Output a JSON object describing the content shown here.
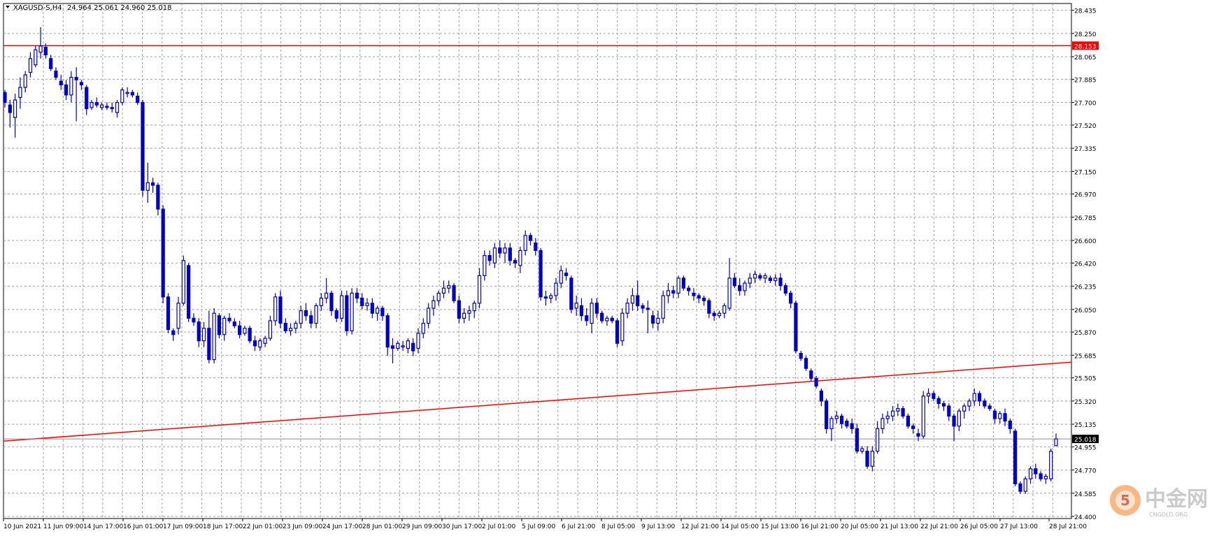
{
  "header": {
    "symbol": "XAGUSD-S,H4",
    "ohlc": "24.964 25.061 24.960 25.018"
  },
  "watermark": {
    "brand": "中金网",
    "url": "CNGOLD.ORG"
  },
  "chart_data": {
    "type": "candlestick",
    "symbol": "XAGUSD-S",
    "timeframe": "H4",
    "ohlc_last": {
      "open": 24.964,
      "high": 25.061,
      "low": 24.96,
      "close": 25.018
    },
    "ylim": [
      24.4,
      28.45
    ],
    "y_ticks": [
      "28.435",
      "28.250",
      "28.065",
      "27.885",
      "27.700",
      "27.520",
      "27.335",
      "27.150",
      "26.970",
      "26.785",
      "26.600",
      "26.420",
      "26.235",
      "26.050",
      "25.870",
      "25.685",
      "25.505",
      "25.320",
      "25.135",
      "24.955",
      "24.770",
      "24.585",
      "24.400"
    ],
    "x_ticks": [
      "10 Jun 2021",
      "11 Jun 09:00",
      "14 Jun 17:00",
      "16 Jun 01:00",
      "17 Jun 09:00",
      "18 Jun 17:00",
      "22 Jun 01:00",
      "23 Jun 09:00",
      "24 Jun 17:00",
      "28 Jun 01:00",
      "29 Jun 09:00",
      "30 Jun 17:00",
      "2 Jul 01:00",
      "5 Jul 09:00",
      "6 Jul 21:00",
      "8 Jul 05:00",
      "9 Jul 13:00",
      "12 Jul 21:00",
      "14 Jul 05:00",
      "15 Jul 13:00",
      "16 Jul 21:00",
      "20 Jul 05:00",
      "21 Jul 13:00",
      "22 Jul 21:00",
      "26 Jul 05:00",
      "27 Jul 13:00",
      "28 Jul 21:00"
    ],
    "horizontal_line": {
      "price": 28.153,
      "label": "28.153",
      "color": "#ff0000"
    },
    "current_price": {
      "price": 25.018,
      "label": "25.018"
    },
    "trendline": {
      "start_price": 25.0,
      "end_price": 25.63,
      "color": "#ff0000"
    },
    "candles": [
      [
        27.78,
        27.8,
        27.66,
        27.7
      ],
      [
        27.68,
        27.72,
        27.5,
        27.62
      ],
      [
        27.58,
        27.77,
        27.42,
        27.72
      ],
      [
        27.74,
        27.9,
        27.65,
        27.82
      ],
      [
        27.82,
        27.95,
        27.78,
        27.92
      ],
      [
        27.94,
        28.1,
        27.9,
        28.05
      ],
      [
        28.0,
        28.15,
        27.98,
        28.12
      ],
      [
        28.1,
        28.3,
        28.05,
        28.15
      ],
      [
        28.14,
        28.17,
        28.05,
        28.08
      ],
      [
        28.05,
        28.08,
        27.95,
        27.97
      ],
      [
        27.95,
        27.98,
        27.88,
        27.9
      ],
      [
        27.87,
        27.92,
        27.8,
        27.84
      ],
      [
        27.84,
        27.88,
        27.72,
        27.76
      ],
      [
        27.76,
        27.95,
        27.7,
        27.9
      ],
      [
        27.9,
        27.98,
        27.55,
        27.88
      ],
      [
        27.86,
        27.88,
        27.8,
        27.84
      ],
      [
        27.82,
        27.84,
        27.6,
        27.65
      ],
      [
        27.66,
        27.72,
        27.64,
        27.7
      ],
      [
        27.7,
        27.74,
        27.66,
        27.68
      ],
      [
        27.66,
        27.7,
        27.64,
        27.68
      ],
      [
        27.67,
        27.7,
        27.64,
        27.66
      ],
      [
        27.66,
        27.7,
        27.62,
        27.65
      ],
      [
        27.62,
        27.72,
        27.58,
        27.7
      ],
      [
        27.7,
        27.82,
        27.68,
        27.8
      ],
      [
        27.78,
        27.82,
        27.74,
        27.78
      ],
      [
        27.78,
        27.8,
        27.74,
        27.76
      ],
      [
        27.75,
        27.78,
        27.68,
        27.7
      ],
      [
        27.7,
        27.72,
        26.95,
        27.0
      ],
      [
        27.0,
        27.22,
        26.9,
        27.06
      ],
      [
        27.06,
        27.1,
        26.98,
        27.04
      ],
      [
        27.04,
        27.06,
        26.8,
        26.85
      ],
      [
        26.85,
        26.88,
        26.1,
        26.15
      ],
      [
        26.15,
        26.18,
        25.86,
        25.89
      ],
      [
        25.88,
        25.9,
        25.8,
        25.85
      ],
      [
        25.9,
        26.15,
        25.85,
        26.1
      ],
      [
        26.1,
        26.48,
        26.08,
        26.44
      ],
      [
        26.4,
        26.42,
        25.95,
        25.98
      ],
      [
        25.98,
        26.02,
        25.92,
        25.95
      ],
      [
        25.95,
        25.98,
        25.75,
        25.8
      ],
      [
        25.8,
        25.95,
        25.75,
        25.9
      ],
      [
        25.9,
        26.04,
        25.62,
        25.65
      ],
      [
        25.65,
        26.06,
        25.62,
        26.02
      ],
      [
        26.0,
        26.02,
        25.82,
        25.85
      ],
      [
        25.85,
        26.0,
        25.8,
        25.98
      ],
      [
        25.98,
        26.02,
        25.94,
        25.96
      ],
      [
        25.95,
        25.98,
        25.9,
        25.92
      ],
      [
        25.92,
        25.96,
        25.82,
        25.85
      ],
      [
        25.86,
        25.92,
        25.84,
        25.9
      ],
      [
        25.9,
        25.92,
        25.78,
        25.8
      ],
      [
        25.8,
        25.84,
        25.72,
        25.76
      ],
      [
        25.75,
        25.82,
        25.72,
        25.8
      ],
      [
        25.78,
        25.84,
        25.75,
        25.82
      ],
      [
        25.82,
        26.0,
        25.8,
        25.96
      ],
      [
        25.96,
        26.18,
        25.92,
        26.15
      ],
      [
        26.15,
        26.2,
        25.9,
        25.94
      ],
      [
        25.94,
        25.98,
        25.86,
        25.88
      ],
      [
        25.88,
        25.94,
        25.84,
        25.9
      ],
      [
        25.9,
        25.96,
        25.86,
        25.94
      ],
      [
        25.94,
        26.08,
        25.9,
        26.04
      ],
      [
        26.04,
        26.1,
        25.96,
        26.0
      ],
      [
        26.0,
        26.04,
        25.9,
        25.94
      ],
      [
        25.94,
        26.1,
        25.9,
        26.08
      ],
      [
        26.08,
        26.18,
        26.04,
        26.14
      ],
      [
        26.14,
        26.3,
        26.1,
        26.18
      ],
      [
        26.18,
        26.2,
        26.0,
        26.04
      ],
      [
        26.04,
        26.06,
        25.95,
        25.98
      ],
      [
        25.98,
        26.2,
        25.95,
        26.16
      ],
      [
        26.16,
        26.2,
        25.84,
        25.88
      ],
      [
        25.88,
        26.22,
        25.85,
        26.18
      ],
      [
        26.18,
        26.22,
        26.1,
        26.14
      ],
      [
        26.14,
        26.18,
        26.05,
        26.08
      ],
      [
        26.08,
        26.14,
        26.04,
        26.1
      ],
      [
        26.1,
        26.14,
        25.98,
        26.02
      ],
      [
        26.02,
        26.08,
        25.96,
        26.06
      ],
      [
        26.06,
        26.08,
        25.96,
        26.0
      ],
      [
        26.0,
        26.02,
        25.68,
        25.75
      ],
      [
        25.76,
        25.82,
        25.62,
        25.74
      ],
      [
        25.74,
        25.8,
        25.72,
        25.78
      ],
      [
        25.76,
        25.8,
        25.72,
        25.76
      ],
      [
        25.74,
        25.82,
        25.7,
        25.8
      ],
      [
        25.78,
        25.82,
        25.68,
        25.72
      ],
      [
        25.74,
        25.9,
        25.7,
        25.86
      ],
      [
        25.86,
        25.98,
        25.82,
        25.94
      ],
      [
        25.94,
        26.1,
        25.9,
        26.06
      ],
      [
        26.06,
        26.16,
        26.0,
        26.12
      ],
      [
        26.12,
        26.2,
        26.08,
        26.18
      ],
      [
        26.18,
        26.28,
        26.14,
        26.22
      ],
      [
        26.22,
        26.28,
        26.18,
        26.24
      ],
      [
        26.24,
        26.26,
        26.1,
        26.12
      ],
      [
        26.12,
        26.16,
        25.94,
        25.98
      ],
      [
        25.98,
        26.06,
        25.94,
        26.02
      ],
      [
        26.02,
        26.08,
        25.96,
        26.04
      ],
      [
        26.04,
        26.12,
        25.98,
        26.1
      ],
      [
        26.1,
        26.38,
        26.06,
        26.32
      ],
      [
        26.32,
        26.52,
        26.28,
        26.48
      ],
      [
        26.48,
        26.52,
        26.4,
        26.44
      ],
      [
        26.42,
        26.58,
        26.38,
        26.54
      ],
      [
        26.54,
        26.6,
        26.46,
        26.5
      ],
      [
        26.5,
        26.58,
        26.42,
        26.54
      ],
      [
        26.54,
        26.58,
        26.4,
        26.44
      ],
      [
        26.44,
        26.46,
        26.38,
        26.42
      ],
      [
        26.4,
        26.55,
        26.34,
        26.52
      ],
      [
        26.52,
        26.68,
        26.48,
        26.64
      ],
      [
        26.64,
        26.66,
        26.56,
        26.6
      ],
      [
        26.58,
        26.62,
        26.48,
        26.52
      ],
      [
        26.52,
        26.54,
        26.12,
        26.15
      ],
      [
        26.15,
        26.2,
        26.08,
        26.14
      ],
      [
        26.14,
        26.18,
        26.1,
        26.16
      ],
      [
        26.16,
        26.3,
        26.12,
        26.26
      ],
      [
        26.26,
        26.4,
        26.22,
        26.36
      ],
      [
        26.34,
        26.38,
        26.28,
        26.32
      ],
      [
        26.3,
        26.32,
        26.02,
        26.05
      ],
      [
        26.06,
        26.16,
        26.0,
        26.1
      ],
      [
        26.08,
        26.14,
        25.96,
        26.0
      ],
      [
        26.0,
        26.06,
        25.92,
        25.96
      ],
      [
        25.94,
        26.14,
        25.86,
        26.1
      ],
      [
        26.1,
        26.14,
        25.98,
        26.02
      ],
      [
        26.02,
        26.04,
        25.94,
        25.96
      ],
      [
        25.96,
        26.0,
        25.92,
        25.98
      ],
      [
        25.98,
        26.0,
        25.94,
        25.96
      ],
      [
        25.96,
        25.98,
        25.75,
        25.78
      ],
      [
        25.8,
        26.06,
        25.76,
        26.02
      ],
      [
        26.02,
        26.14,
        25.98,
        26.1
      ],
      [
        26.1,
        26.22,
        26.04,
        26.16
      ],
      [
        26.16,
        26.28,
        26.04,
        26.08
      ],
      [
        26.08,
        26.1,
        26.02,
        26.06
      ],
      [
        26.06,
        26.12,
        25.86,
        26.05
      ],
      [
        26.0,
        26.04,
        25.9,
        25.94
      ],
      [
        25.94,
        26.04,
        25.88,
        25.98
      ],
      [
        25.98,
        26.2,
        25.94,
        26.16
      ],
      [
        26.16,
        26.26,
        26.1,
        26.2
      ],
      [
        26.2,
        26.24,
        26.14,
        26.18
      ],
      [
        26.18,
        26.32,
        26.14,
        26.3
      ],
      [
        26.3,
        26.32,
        26.2,
        26.22
      ],
      [
        26.22,
        26.24,
        26.16,
        26.2
      ],
      [
        26.18,
        26.22,
        26.12,
        26.16
      ],
      [
        26.16,
        26.18,
        26.1,
        26.14
      ],
      [
        26.14,
        26.16,
        26.08,
        26.12
      ],
      [
        26.12,
        26.14,
        25.98,
        26.02
      ],
      [
        26.02,
        26.04,
        25.96,
        26.0
      ],
      [
        26.0,
        26.04,
        25.98,
        26.02
      ],
      [
        26.02,
        26.1,
        25.98,
        26.08
      ],
      [
        26.06,
        26.46,
        26.04,
        26.3
      ],
      [
        26.3,
        26.34,
        26.22,
        26.24
      ],
      [
        26.24,
        26.3,
        26.16,
        26.2
      ],
      [
        26.2,
        26.28,
        26.16,
        26.26
      ],
      [
        26.26,
        26.34,
        26.22,
        26.3
      ],
      [
        26.3,
        26.36,
        26.26,
        26.33
      ],
      [
        26.32,
        26.34,
        26.28,
        26.3
      ],
      [
        26.3,
        26.34,
        26.26,
        26.32
      ],
      [
        26.3,
        26.32,
        26.26,
        26.28
      ],
      [
        26.28,
        26.33,
        26.24,
        26.3
      ],
      [
        26.3,
        26.34,
        26.2,
        26.24
      ],
      [
        26.24,
        26.26,
        26.16,
        26.18
      ],
      [
        26.18,
        26.2,
        26.06,
        26.1
      ],
      [
        26.1,
        26.12,
        25.7,
        25.72
      ],
      [
        25.7,
        25.72,
        25.64,
        25.66
      ],
      [
        25.66,
        25.68,
        25.56,
        25.58
      ],
      [
        25.56,
        25.58,
        25.48,
        25.5
      ],
      [
        25.5,
        25.52,
        25.42,
        25.44
      ],
      [
        25.4,
        25.42,
        25.28,
        25.32
      ],
      [
        25.32,
        25.34,
        25.06,
        25.1
      ],
      [
        25.1,
        25.2,
        25.0,
        25.18
      ],
      [
        25.18,
        25.24,
        25.14,
        25.2
      ],
      [
        25.2,
        25.22,
        25.1,
        25.14
      ],
      [
        25.16,
        25.18,
        25.1,
        25.12
      ],
      [
        25.14,
        25.18,
        25.06,
        25.1
      ],
      [
        25.1,
        25.14,
        24.9,
        24.92
      ],
      [
        24.92,
        24.96,
        24.9,
        24.94
      ],
      [
        24.92,
        24.96,
        24.78,
        24.8
      ],
      [
        24.8,
        24.96,
        24.76,
        24.92
      ],
      [
        24.92,
        25.16,
        24.9,
        25.1
      ],
      [
        25.1,
        25.22,
        25.06,
        25.18
      ],
      [
        25.18,
        25.24,
        25.14,
        25.2
      ],
      [
        25.2,
        25.28,
        25.16,
        25.24
      ],
      [
        25.24,
        25.3,
        25.2,
        25.26
      ],
      [
        25.26,
        25.28,
        25.18,
        25.2
      ],
      [
        25.2,
        25.22,
        25.1,
        25.12
      ],
      [
        25.12,
        25.14,
        25.06,
        25.1
      ],
      [
        25.06,
        25.1,
        25.0,
        25.04
      ],
      [
        25.04,
        25.4,
        25.02,
        25.36
      ],
      [
        25.36,
        25.42,
        25.3,
        25.38
      ],
      [
        25.38,
        25.4,
        25.32,
        25.34
      ],
      [
        25.34,
        25.36,
        25.26,
        25.3
      ],
      [
        25.3,
        25.32,
        25.24,
        25.28
      ],
      [
        25.28,
        25.3,
        25.16,
        25.2
      ],
      [
        25.2,
        25.22,
        25.0,
        25.12
      ],
      [
        25.12,
        25.26,
        25.08,
        25.24
      ],
      [
        25.24,
        25.3,
        25.18,
        25.28
      ],
      [
        25.28,
        25.34,
        25.24,
        25.32
      ],
      [
        25.32,
        25.42,
        25.28,
        25.38
      ],
      [
        25.38,
        25.4,
        25.28,
        25.32
      ],
      [
        25.32,
        25.34,
        25.26,
        25.28
      ],
      [
        25.28,
        25.3,
        25.24,
        25.26
      ],
      [
        25.24,
        25.26,
        25.14,
        25.18
      ],
      [
        25.18,
        25.24,
        25.14,
        25.22
      ],
      [
        25.22,
        25.26,
        25.12,
        25.16
      ],
      [
        25.16,
        25.18,
        25.06,
        25.1
      ],
      [
        25.08,
        25.1,
        24.64,
        24.66
      ],
      [
        24.66,
        24.68,
        24.58,
        24.6
      ],
      [
        24.6,
        24.72,
        24.58,
        24.7
      ],
      [
        24.7,
        24.8,
        24.66,
        24.78
      ],
      [
        24.78,
        24.82,
        24.7,
        24.74
      ],
      [
        24.74,
        24.76,
        24.68,
        24.7
      ],
      [
        24.7,
        24.74,
        24.66,
        24.72
      ],
      [
        24.7,
        24.94,
        24.68,
        24.92
      ],
      [
        24.964,
        25.061,
        24.96,
        25.018
      ]
    ]
  }
}
